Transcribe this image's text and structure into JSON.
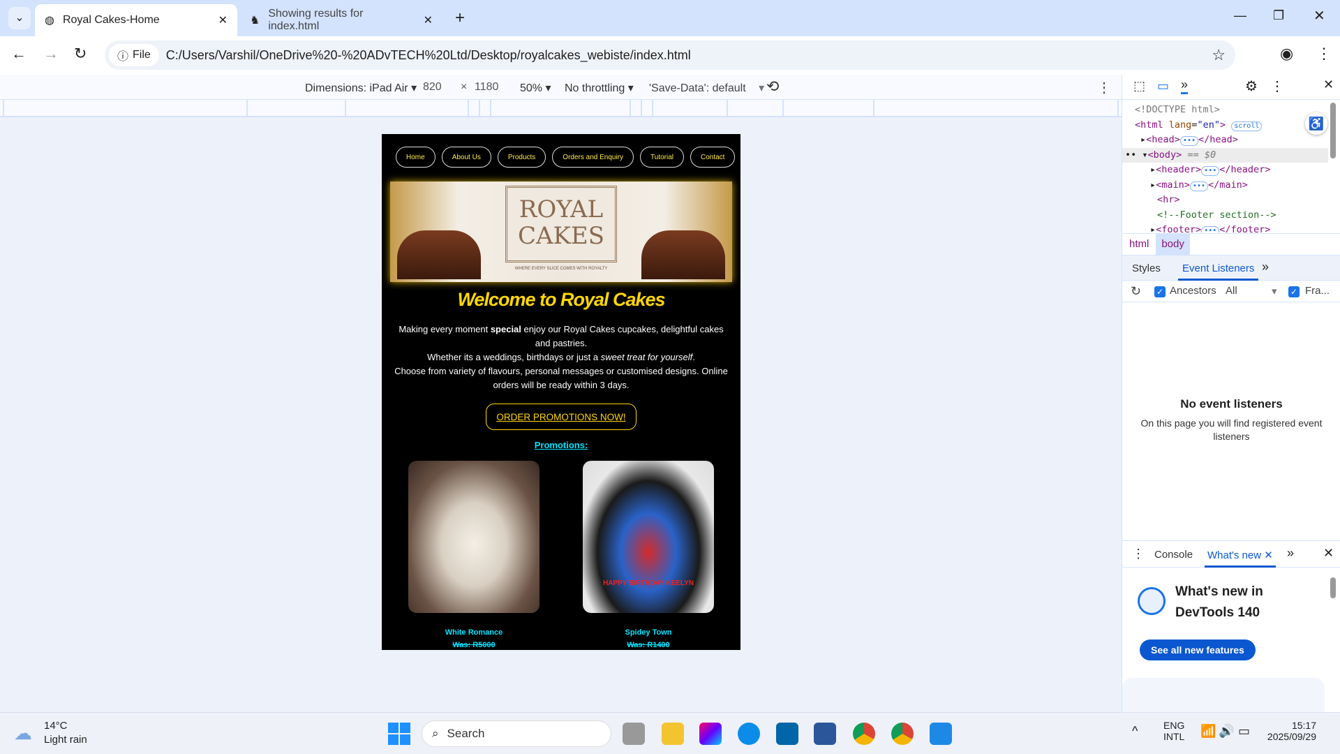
{
  "browser": {
    "tabs": [
      {
        "title": "Royal Cakes-Home",
        "active": true
      },
      {
        "title": "Showing results for index.html",
        "active": false
      }
    ],
    "new_tab": "+",
    "address_chip": "File",
    "url": "C:/Users/Varshil/OneDrive%20-%20ADvTECH%20Ltd/Desktop/royalcakes_webiste/index.html"
  },
  "device_toolbar": {
    "dimensions": "Dimensions: iPad Air",
    "width": "820",
    "x": "×",
    "height": "1180",
    "zoom": "50%",
    "throttling": "No throttling",
    "save_data": "'Save-Data': default"
  },
  "page": {
    "nav": [
      "Home",
      "About Us",
      "Products",
      "Orders and Enquiry",
      "Tutorial",
      "Contact"
    ],
    "banner": {
      "logo_line1": "ROYAL",
      "logo_line2": "CAKES",
      "tagline": "WHERE EVERY SLICE COMES WITH ROYALTY"
    },
    "welcome": "Welcome to Royal Cakes",
    "p1a": "Making every moment ",
    "p1b": "special",
    "p1c": " enjoy our Royal Cakes cupcakes, delightful cakes and pastries.",
    "p2a": "Whether its a weddings, birthdays or just a ",
    "p2b": "sweet treat for yourself",
    "p2c": ".",
    "p3": "Choose from variety of flavours, personal messages or customised designs. Online orders will be ready within 3 days.",
    "order_button": "ORDER PROMOTIONS NOW!",
    "promotions_heading": "Promotions:",
    "products": [
      {
        "name": "White Romance",
        "price": "Was: R5000"
      },
      {
        "name": "Spidey Town",
        "price": "Was: R1400",
        "cake_text": "HAPPY BIRTHDAY KEELYN"
      }
    ]
  },
  "devtools": {
    "dom": {
      "doctype": "<!DOCTYPE html>",
      "scroll_badge": "scroll",
      "body_suffix": "== $0",
      "comment": "<!--Footer section-->"
    },
    "breadcrumbs": [
      "html",
      "body"
    ],
    "tabs": [
      "Styles",
      "Event Listeners"
    ],
    "ancestors": "Ancestors",
    "filter": "All",
    "framework": "Fra...",
    "empty_title": "No event listeners",
    "empty_desc": "On this page you will find registered event listeners",
    "drawer_tabs": [
      "Console",
      "What's new"
    ],
    "whats_new_title": "What's new in DevTools 140",
    "see_all": "See all new features"
  },
  "taskbar": {
    "temp": "14°C",
    "weather": "Light rain",
    "search": "Search",
    "lang1": "ENG",
    "lang2": "INTL",
    "time": "15:17",
    "date": "2025/09/29"
  }
}
